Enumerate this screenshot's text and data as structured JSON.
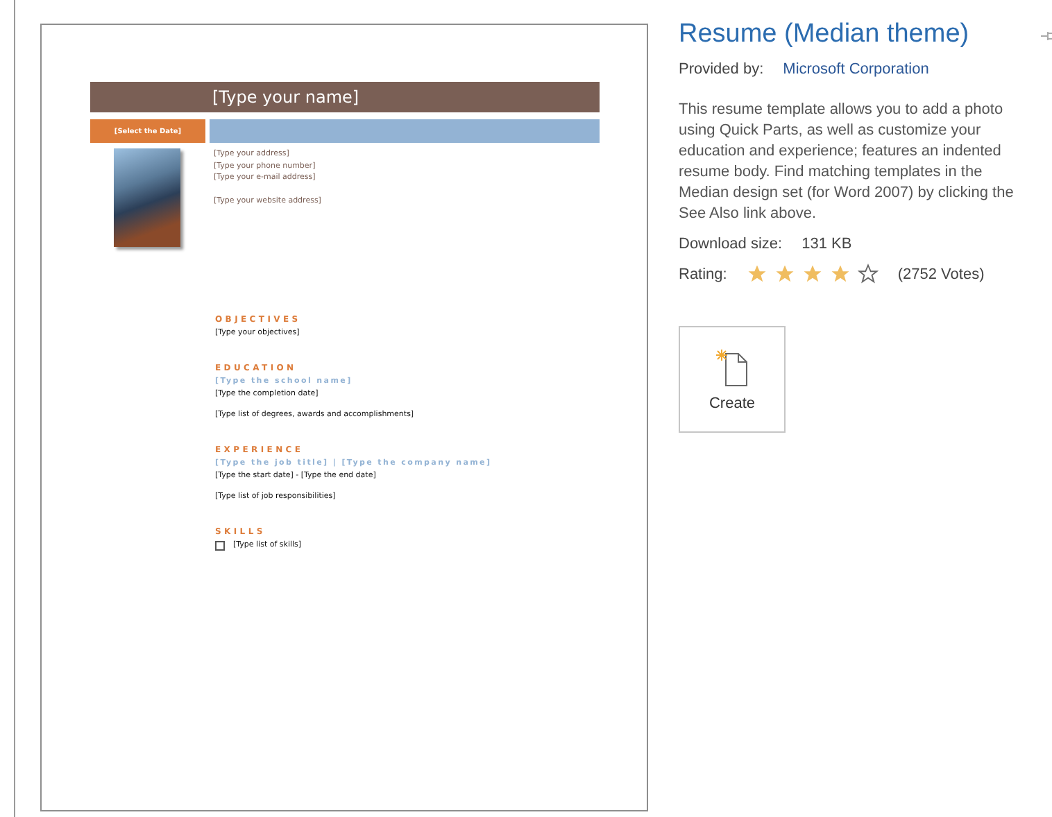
{
  "preview": {
    "name_placeholder": "[Type your name]",
    "date_placeholder": "[Select the Date]",
    "contact": [
      "[Type your address]",
      "[Type your phone number]",
      "[Type your e-mail address]"
    ],
    "website": "[Type your website address]",
    "sections": [
      {
        "heading": "OBJECTIVES",
        "lines": [
          {
            "kind": "plain",
            "text": "[Type your objectives]"
          }
        ]
      },
      {
        "heading": "EDUCATION",
        "lines": [
          {
            "kind": "accent",
            "text": "[Type the school name]"
          },
          {
            "kind": "plain",
            "text": "[Type the completion date]"
          },
          {
            "kind": "spaced",
            "text": "[Type list of degrees, awards and accomplishments]"
          }
        ]
      },
      {
        "heading": "EXPERIENCE",
        "lines": [
          {
            "kind": "accent",
            "text": "[Type the job title]  |  [Type the company name]"
          },
          {
            "kind": "plain",
            "text": "[Type the start date] - [Type the end date]"
          },
          {
            "kind": "spaced",
            "text": "[Type list of job responsibilities]"
          }
        ]
      },
      {
        "heading": "SKILLS",
        "lines": [
          {
            "kind": "bullet",
            "text": "[Type list of skills]"
          }
        ]
      }
    ]
  },
  "details": {
    "title": "Resume (Median theme)",
    "provider_label": "Provided by:",
    "provider": "Microsoft Corporation",
    "description": "This resume template allows you to add a photo using Quick Parts, as well as customize your education and experience; features an indented resume body. Find matching templates in the Median design set (for Word 2007) by clicking the See Also link above.",
    "size_label": "Download size:",
    "size": "131 KB",
    "rating_label": "Rating:",
    "stars": 4,
    "votes": "(2752 Votes)",
    "create_label": "Create"
  }
}
